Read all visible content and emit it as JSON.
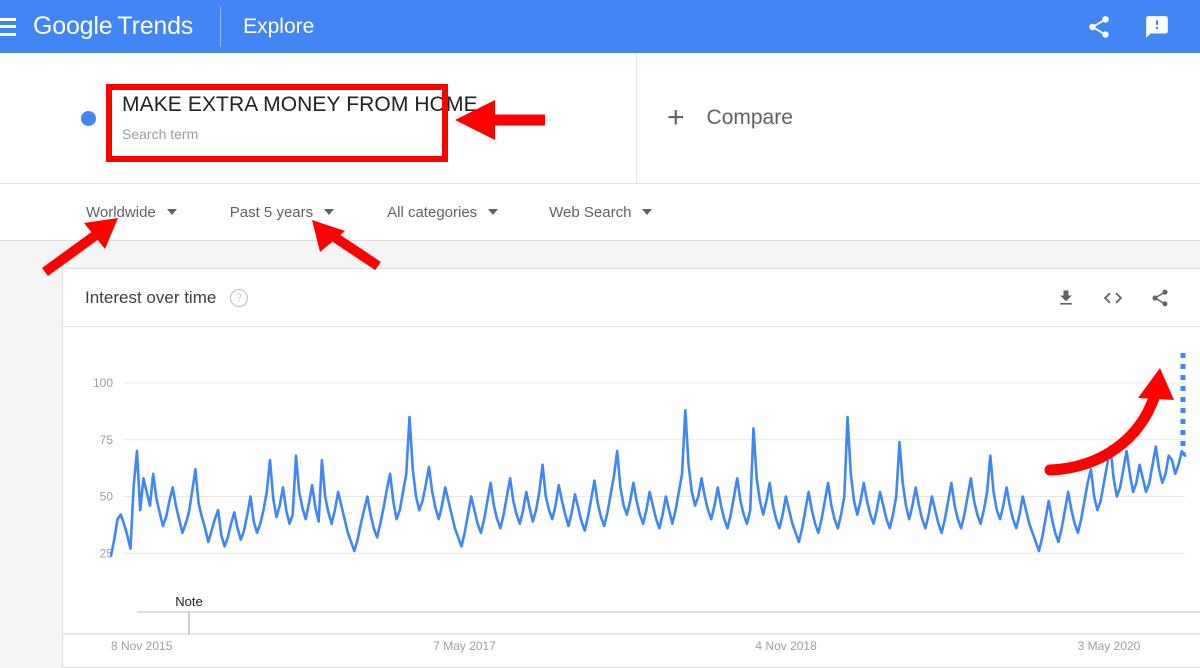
{
  "header": {
    "menu_icon": "hamburger-icon",
    "brand_google": "Google",
    "brand_trends": "Trends",
    "explore": "Explore",
    "share_icon": "share-icon",
    "feedback_icon": "feedback-icon",
    "background_color": "#4285f4"
  },
  "query": {
    "dot_color": "#4285f4",
    "term": "MAKE EXTRA MONEY FROM HOME",
    "term_type": "Search term",
    "compare_label": "Compare",
    "compare_icon": "plus-icon"
  },
  "filters": [
    {
      "label": "Worldwide",
      "name": "location-filter"
    },
    {
      "label": "Past 5 years",
      "name": "time-range-filter"
    },
    {
      "label": "All categories",
      "name": "category-filter"
    },
    {
      "label": "Web Search",
      "name": "search-type-filter"
    }
  ],
  "card": {
    "title": "Interest over time",
    "help_icon": "help-circle-icon",
    "help_glyph": "?",
    "download_icon": "download-icon",
    "embed_icon": "embed-code-icon",
    "share_icon": "share-icon"
  },
  "annotations": {
    "box_color": "#ff0000",
    "arrow_color": "#ff0000",
    "note_label": "Note"
  },
  "chart_data": {
    "type": "line",
    "title": "Interest over time",
    "xlabel": "",
    "ylabel": "",
    "ylim": [
      0,
      100
    ],
    "yticks": [
      25,
      50,
      75,
      100
    ],
    "ytick_labels": [
      "25",
      "50",
      "75",
      "100"
    ],
    "xtick_labels": [
      "8 Nov 2015",
      "7 May 2017",
      "4 Nov 2018",
      "3 May 2020"
    ],
    "xtick_positions": [
      0,
      0.3,
      0.6,
      0.9
    ],
    "grid": true,
    "legend": false,
    "line_color": "#4285f4",
    "partial_data_marker": "dotted-vertical-line",
    "series": [
      {
        "name": "MAKE EXTRA MONEY FROM HOME",
        "values": [
          24,
          31,
          40,
          42,
          38,
          33,
          27,
          55,
          70,
          44,
          58,
          52,
          46,
          60,
          49,
          43,
          37,
          41,
          48,
          54,
          46,
          40,
          34,
          38,
          43,
          52,
          62,
          47,
          41,
          36,
          30,
          35,
          40,
          44,
          33,
          28,
          32,
          38,
          43,
          36,
          31,
          35,
          42,
          50,
          39,
          34,
          38,
          44,
          52,
          66,
          49,
          41,
          46,
          54,
          44,
          38,
          42,
          68,
          52,
          45,
          40,
          47,
          55,
          45,
          39,
          66,
          50,
          43,
          38,
          44,
          52,
          46,
          40,
          34,
          30,
          26,
          31,
          38,
          44,
          50,
          42,
          36,
          32,
          38,
          45,
          53,
          60,
          48,
          40,
          44,
          52,
          60,
          85,
          62,
          50,
          44,
          48,
          55,
          63,
          52,
          45,
          40,
          46,
          54,
          48,
          42,
          36,
          32,
          28,
          34,
          42,
          50,
          44,
          38,
          34,
          40,
          48,
          56,
          46,
          40,
          36,
          42,
          50,
          58,
          48,
          42,
          38,
          44,
          52,
          45,
          39,
          44,
          52,
          64,
          50,
          44,
          40,
          46,
          55,
          48,
          42,
          37,
          43,
          51,
          45,
          39,
          35,
          41,
          49,
          57,
          47,
          41,
          37,
          43,
          51,
          59,
          70,
          54,
          46,
          42,
          48,
          56,
          48,
          42,
          38,
          44,
          52,
          46,
          40,
          36,
          42,
          50,
          44,
          38,
          44,
          52,
          60,
          88,
          64,
          52,
          46,
          50,
          58,
          50,
          44,
          40,
          46,
          54,
          46,
          40,
          36,
          42,
          50,
          58,
          48,
          42,
          38,
          44,
          80,
          58,
          48,
          42,
          48,
          56,
          46,
          40,
          36,
          42,
          50,
          44,
          38,
          34,
          30,
          36,
          44,
          52,
          44,
          38,
          34,
          40,
          48,
          56,
          46,
          40,
          36,
          42,
          50,
          85,
          60,
          48,
          42,
          48,
          56,
          48,
          42,
          38,
          44,
          52,
          46,
          40,
          36,
          42,
          50,
          74,
          56,
          46,
          40,
          46,
          54,
          46,
          40,
          36,
          42,
          50,
          44,
          38,
          34,
          40,
          48,
          56,
          46,
          40,
          36,
          42,
          50,
          58,
          48,
          42,
          38,
          44,
          52,
          68,
          52,
          44,
          40,
          46,
          54,
          46,
          40,
          36,
          42,
          50,
          44,
          38,
          34,
          30,
          26,
          32,
          40,
          48,
          40,
          34,
          30,
          36,
          44,
          52,
          44,
          38,
          34,
          40,
          48,
          56,
          62,
          50,
          44,
          48,
          56,
          64,
          72,
          58,
          50,
          54,
          62,
          70,
          60,
          52,
          56,
          64,
          58,
          52,
          56,
          64,
          72,
          62,
          56,
          60,
          68,
          66,
          60,
          64,
          70,
          68
        ]
      }
    ]
  }
}
